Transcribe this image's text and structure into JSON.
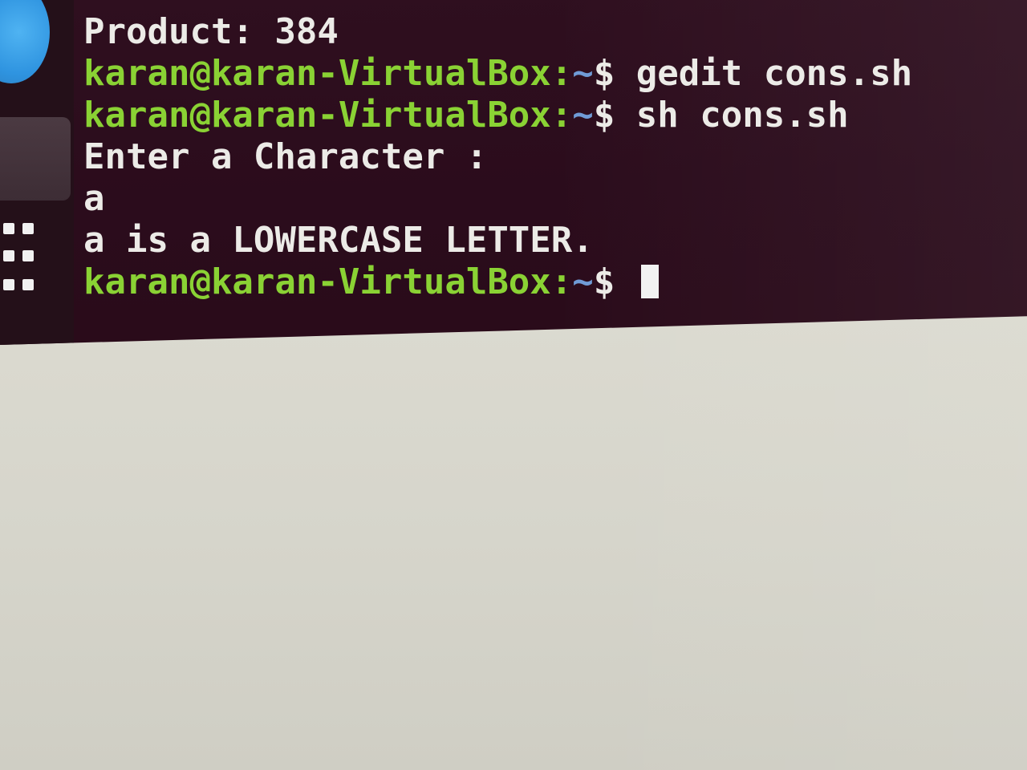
{
  "terminal": {
    "lines": [
      {
        "segments": [
          {
            "text": "Product: 384",
            "color": "white"
          }
        ]
      },
      {
        "segments": [
          {
            "text": "karan@karan-VirtualBox:",
            "color": "green"
          },
          {
            "text": "~",
            "color": "blue"
          },
          {
            "text": "$ gedit cons.sh",
            "color": "white"
          }
        ]
      },
      {
        "segments": [
          {
            "text": "karan@karan-VirtualBox:",
            "color": "green"
          },
          {
            "text": "~",
            "color": "blue"
          },
          {
            "text": "$ sh cons.sh",
            "color": "white"
          }
        ]
      },
      {
        "segments": [
          {
            "text": "Enter a Character :",
            "color": "white"
          }
        ]
      },
      {
        "segments": [
          {
            "text": "a",
            "color": "white"
          }
        ]
      },
      {
        "segments": [
          {
            "text": "a is a LOWERCASE LETTER.",
            "color": "white"
          }
        ]
      },
      {
        "segments": [
          {
            "text": "karan@karan-VirtualBox:",
            "color": "green"
          },
          {
            "text": "~",
            "color": "blue"
          },
          {
            "text": "$ ",
            "color": "white"
          }
        ],
        "cursor": true
      }
    ]
  },
  "colors": {
    "background": "#2c0d1c",
    "prompt_user_host": "#8ad234",
    "prompt_path": "#6f9bd6",
    "text": "#ecebe7",
    "dock_icon": "#2f94e0"
  },
  "icons": {
    "dock_app": "terminal-app-icon",
    "apps_grid": "show-applications-icon"
  }
}
